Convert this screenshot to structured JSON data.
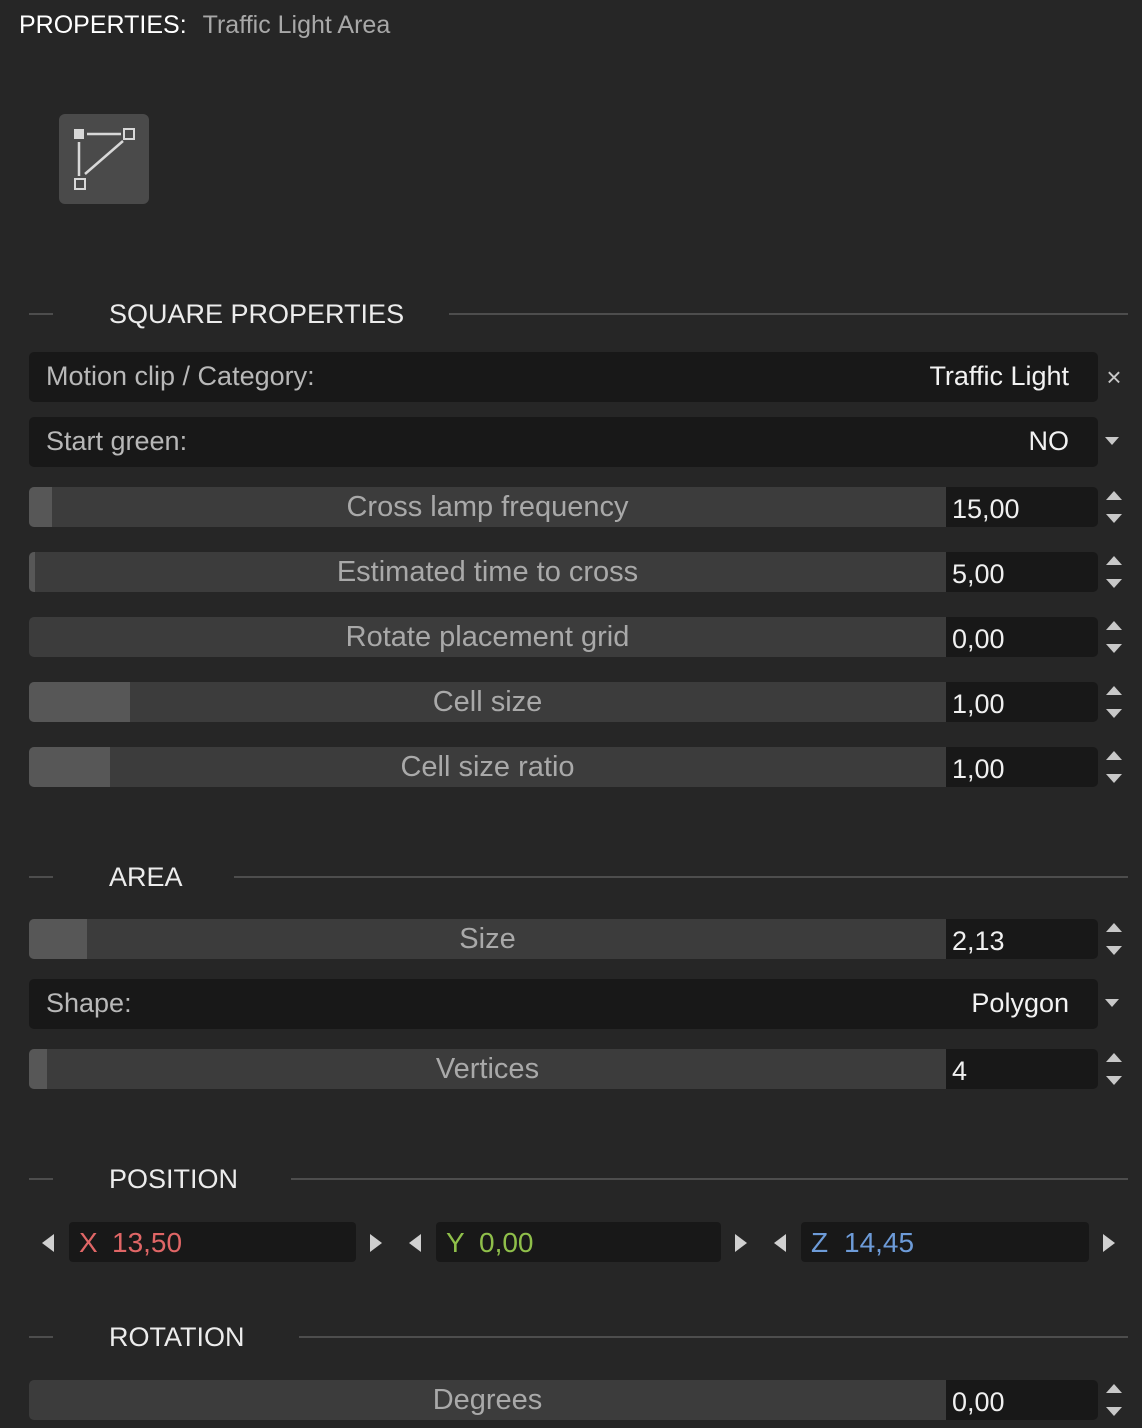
{
  "header": {
    "label": "PROPERTIES:",
    "value": "Traffic Light Area"
  },
  "toolbar": {
    "icon": "polygon-edit-icon"
  },
  "square": {
    "title": "SQUARE PROPERTIES",
    "motion_clip": {
      "label": "Motion clip / Category:",
      "value": "Traffic Light",
      "clear": "×"
    },
    "start_green": {
      "label": "Start green:",
      "value": "NO"
    },
    "sliders": [
      {
        "label": "Cross lamp frequency",
        "value": "15,00",
        "fill": 0.025
      },
      {
        "label": "Estimated time to cross",
        "value": "5,00",
        "fill": 0.006
      },
      {
        "label": "Rotate placement grid",
        "value": "0,00",
        "fill": 0.0
      },
      {
        "label": "Cell size",
        "value": "1,00",
        "fill": 0.11
      },
      {
        "label": "Cell size ratio",
        "value": "1,00",
        "fill": 0.088
      }
    ]
  },
  "area": {
    "title": "AREA",
    "size": {
      "label": "Size",
      "value": "2,13",
      "fill": 0.063
    },
    "shape": {
      "label": "Shape:",
      "value": "Polygon"
    },
    "vertices": {
      "label": "Vertices",
      "value": "4",
      "fill": 0.02
    }
  },
  "position": {
    "title": "POSITION",
    "x": {
      "axis": "X",
      "value": "13,50",
      "color": "#e06666"
    },
    "y": {
      "axis": "Y",
      "value": "0,00",
      "color": "#8fbf4a"
    },
    "z": {
      "axis": "Z",
      "value": "14,45",
      "color": "#6d9bd8"
    }
  },
  "rotation": {
    "title": "ROTATION",
    "degrees": {
      "label": "Degrees",
      "value": "0,00",
      "fill": 0.0
    }
  }
}
